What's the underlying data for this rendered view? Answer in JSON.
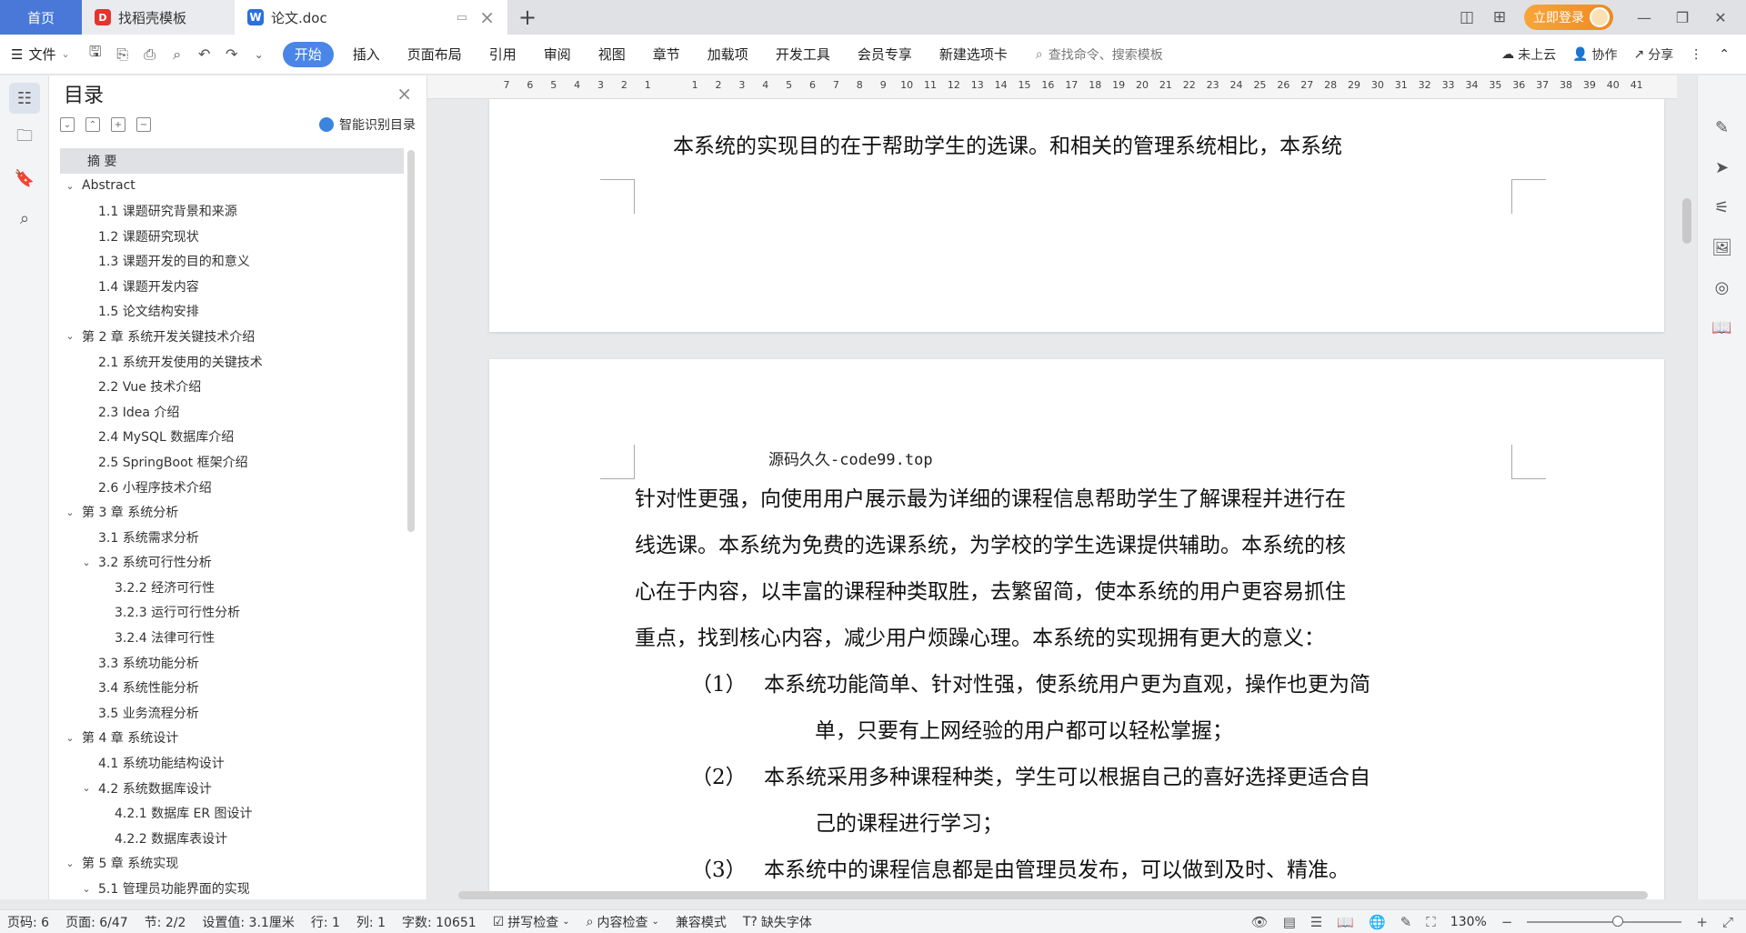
{
  "titlebar": {
    "tabs": [
      {
        "label": "首页"
      },
      {
        "label": "找稻壳模板"
      },
      {
        "label": "论文.doc"
      }
    ],
    "login_label": "立即登录"
  },
  "ribbon": {
    "file_label": "文件",
    "menu": [
      "开始",
      "插入",
      "页面布局",
      "引用",
      "审阅",
      "视图",
      "章节",
      "加载项",
      "开发工具",
      "会员专享",
      "新建选项卡"
    ],
    "search_placeholder": "查找命令、搜索模板",
    "cloud_label": "未上云",
    "collab_label": "协作",
    "share_label": "分享"
  },
  "toc": {
    "title": "目录",
    "smart_label": "智能识别目录",
    "items": [
      {
        "label": "摘  要",
        "level": 1,
        "chev": "",
        "selected": true
      },
      {
        "label": "Abstract",
        "level": 1,
        "chev": "v"
      },
      {
        "label": "1.1 课题研究背景和来源",
        "level": 2,
        "chev": ""
      },
      {
        "label": "1.2 课题研究现状",
        "level": 2,
        "chev": ""
      },
      {
        "label": "1.3 课题开发的目的和意义",
        "level": 2,
        "chev": ""
      },
      {
        "label": "1.4 课题开发内容",
        "level": 2,
        "chev": ""
      },
      {
        "label": "1.5 论文结构安排",
        "level": 2,
        "chev": ""
      },
      {
        "label": "第 2 章  系统开发关键技术介绍",
        "level": 1,
        "chev": "v"
      },
      {
        "label": "2.1 系统开发使用的关键技术",
        "level": 2,
        "chev": ""
      },
      {
        "label": "2.2 Vue 技术介绍",
        "level": 2,
        "chev": ""
      },
      {
        "label": "2.3 Idea 介绍",
        "level": 2,
        "chev": ""
      },
      {
        "label": "2.4 MySQL 数据库介绍",
        "level": 2,
        "chev": ""
      },
      {
        "label": "2.5 SpringBoot 框架介绍",
        "level": 2,
        "chev": ""
      },
      {
        "label": "2.6 小程序技术介绍",
        "level": 2,
        "chev": ""
      },
      {
        "label": "第 3 章  系统分析",
        "level": 1,
        "chev": "v"
      },
      {
        "label": "3.1 系统需求分析",
        "level": 2,
        "chev": ""
      },
      {
        "label": "3.2 系统可行性分析",
        "level": 2,
        "chev": "v"
      },
      {
        "label": "3.2.2 经济可行性",
        "level": 3,
        "chev": ""
      },
      {
        "label": "3.2.3 运行可行性分析",
        "level": 3,
        "chev": ""
      },
      {
        "label": "3.2.4 法律可行性",
        "level": 3,
        "chev": ""
      },
      {
        "label": "3.3 系统功能分析",
        "level": 2,
        "chev": ""
      },
      {
        "label": "3.4 系统性能分析",
        "level": 2,
        "chev": ""
      },
      {
        "label": "3.5 业务流程分析",
        "level": 2,
        "chev": ""
      },
      {
        "label": "第 4 章  系统设计",
        "level": 1,
        "chev": "v"
      },
      {
        "label": "4.1 系统功能结构设计",
        "level": 2,
        "chev": ""
      },
      {
        "label": "4.2 系统数据库设计",
        "level": 2,
        "chev": "v"
      },
      {
        "label": "4.2.1 数据库 ER 图设计",
        "level": 3,
        "chev": ""
      },
      {
        "label": "4.2.2 数据库表设计",
        "level": 3,
        "chev": ""
      },
      {
        "label": "第 5 章  系统实现",
        "level": 1,
        "chev": "v"
      },
      {
        "label": "5.1 管理员功能界面的实现",
        "level": 2,
        "chev": "v"
      }
    ]
  },
  "ruler": {
    "numbers": [
      "7",
      "6",
      "5",
      "4",
      "3",
      "2",
      "1",
      "",
      "1",
      "2",
      "3",
      "4",
      "5",
      "6",
      "7",
      "8",
      "9",
      "10",
      "11",
      "12",
      "13",
      "14",
      "15",
      "16",
      "17",
      "18",
      "19",
      "20",
      "21",
      "22",
      "23",
      "24",
      "25",
      "26",
      "27",
      "28",
      "29",
      "30",
      "31",
      "32",
      "33",
      "34",
      "35",
      "36",
      "37",
      "38",
      "39",
      "40",
      "41"
    ]
  },
  "document": {
    "page1_line": "本系统的实现目的在于帮助学生的选课。和相关的管理系统相比，本系统",
    "watermark": "源码久久-code99.top",
    "page2_lines": [
      "针对性更强，向使用用户展示最为详细的课程信息帮助学生了解课程并进行在",
      "线选课。本系统为免费的选课系统，为学校的学生选课提供辅助。本系统的核",
      "心在于内容，以丰富的课程种类取胜，去繁留简，使本系统的用户更容易抓住",
      "重点，找到核心内容，减少用户烦躁心理。本系统的实现拥有更大的意义："
    ],
    "list": [
      {
        "num": "（1）",
        "line1": "本系统功能简单、针对性强，使系统用户更为直观，操作也更为简",
        "line2": "单，只要有上网经验的用户都可以轻松掌握；"
      },
      {
        "num": "（2）",
        "line1": "本系统采用多种课程种类，学生可以根据自己的喜好选择更适合自",
        "line2": "己的课程进行学习；"
      },
      {
        "num": "（3）",
        "line1": "本系统中的课程信息都是由管理员发布，可以做到及时、精准。",
        "line2": ""
      }
    ]
  },
  "statusbar": {
    "page_code": "页码: 6",
    "page": "页面: 6/47",
    "section": "节: 2/2",
    "setting": "设置值: 3.1厘米",
    "row": "行: 1",
    "col": "列: 1",
    "words": "字数: 10651",
    "spell": "拼写检查",
    "content_check": "内容检查",
    "compat": "兼容模式",
    "missing_font": "缺失字体",
    "zoom": "130%",
    "zoom_level": 0.55
  }
}
